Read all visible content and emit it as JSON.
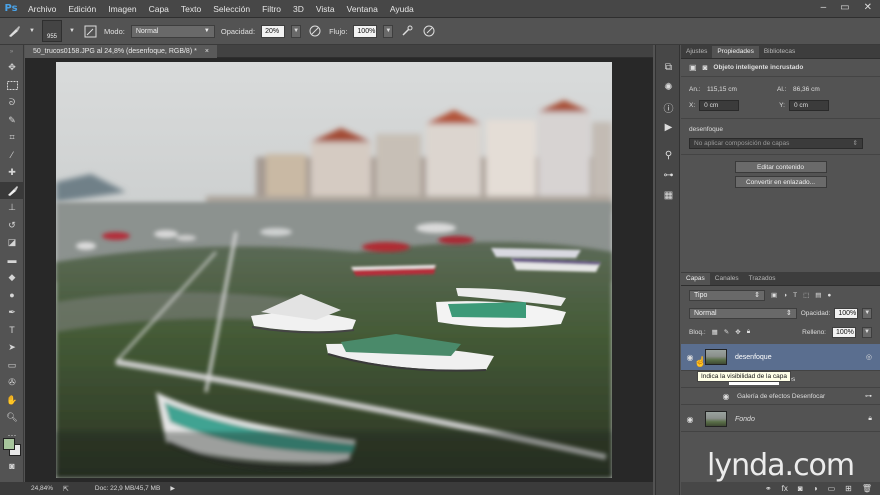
{
  "app": {
    "logo": "Ps",
    "accent": "#4aa3e8"
  },
  "menu": [
    "Archivo",
    "Edición",
    "Imagen",
    "Capa",
    "Texto",
    "Selección",
    "Filtro",
    "3D",
    "Vista",
    "Ventana",
    "Ayuda"
  ],
  "window_controls": {
    "minimize": "–",
    "restore": "▭",
    "close": "✕"
  },
  "options": {
    "brush_size": "955",
    "mode_label": "Modo:",
    "mode_value": "Normal",
    "opacity_label": "Opacidad:",
    "opacity_value": "20%",
    "flow_label": "Flujo:",
    "flow_value": "100%"
  },
  "document": {
    "tab_title": "50_trucos0158.JPG al 24,8% (desenfoque, RGB/8) *",
    "close": "×"
  },
  "status": {
    "zoom": "24,84%",
    "doc_info": "Doc: 22,9 MB/45,7 MB"
  },
  "properties_panel": {
    "tabs": [
      "Ajustes",
      "Propiedades",
      "Bibliotecas"
    ],
    "active_tab": 1,
    "object_title": "Objeto inteligente incrustado",
    "an_label": "An.:",
    "an_value": "115,15 cm",
    "al_label": "Al.:",
    "al_value": "86,36 cm",
    "x_label": "X:",
    "x_value": "0 cm",
    "y_label": "Y:",
    "y_value": "0 cm",
    "layer_name": "desenfoque",
    "comp_placeholder": "No aplicar composición de capas",
    "edit_button": "Editar contenido",
    "convert_button": "Convertir en enlazado..."
  },
  "layers_panel": {
    "tabs": [
      "Capas",
      "Canales",
      "Trazados"
    ],
    "active_tab": 0,
    "filter_value": "Tipo",
    "blend_mode": "Normal",
    "opacity_label": "Opacidad:",
    "opacity_value": "100%",
    "lock_label": "Bloq.:",
    "fill_label": "Relleno:",
    "fill_value": "100%",
    "layers": [
      {
        "name": "desenfoque",
        "selected": true
      },
      {
        "name": "Filtros inteligentes",
        "selected": false
      },
      {
        "name": "Galería de efectos Desenfocar",
        "selected": false
      },
      {
        "name": "Fondo",
        "selected": false
      }
    ],
    "smart_filters_visible_fragment": "ntes",
    "selected_layer_color": "#5a6e8f"
  },
  "tooltip": "Indica la visibilidad de la capa",
  "watermark": "lynda.com"
}
